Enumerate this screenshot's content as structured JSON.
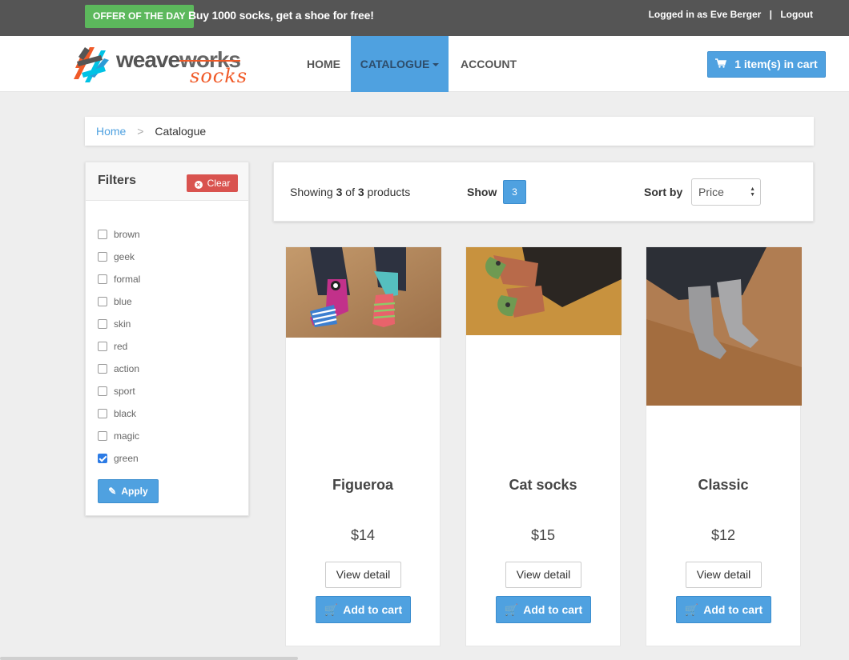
{
  "topbar": {
    "offer_badge": "OFFER OF THE DAY",
    "offer_text": "Buy 1000 socks, get a shoe for free!",
    "logged_in": "Logged in as Eve Berger",
    "separator": "|",
    "logout": "Logout"
  },
  "logo": {
    "word": "weave",
    "word2": "works",
    "sub": "socks"
  },
  "nav": {
    "home": "HOME",
    "catalogue": "CATALOGUE",
    "account": "ACCOUNT",
    "cart": "1 item(s) in cart"
  },
  "breadcrumb": {
    "home": "Home",
    "separator": ">",
    "current": "Catalogue"
  },
  "filters": {
    "title": "Filters",
    "clear": "Clear",
    "apply": "Apply",
    "items": [
      {
        "label": "brown",
        "checked": false
      },
      {
        "label": "geek",
        "checked": false
      },
      {
        "label": "formal",
        "checked": false
      },
      {
        "label": "blue",
        "checked": false
      },
      {
        "label": "skin",
        "checked": false
      },
      {
        "label": "red",
        "checked": false
      },
      {
        "label": "action",
        "checked": false
      },
      {
        "label": "sport",
        "checked": false
      },
      {
        "label": "black",
        "checked": false
      },
      {
        "label": "magic",
        "checked": false
      },
      {
        "label": "green",
        "checked": true
      }
    ]
  },
  "info": {
    "showing_prefix": "Showing",
    "showing_count": "3",
    "showing_of": "of",
    "showing_total": "3",
    "showing_suffix": "products",
    "show_label": "Show",
    "show_value": "3",
    "sort_label": "Sort by",
    "sort_value": "Price"
  },
  "products": [
    {
      "name": "Figueroa",
      "price": "$14",
      "view": "View detail",
      "add": "Add to cart"
    },
    {
      "name": "Cat socks",
      "price": "$15",
      "view": "View detail",
      "add": "Add to cart"
    },
    {
      "name": "Classic",
      "price": "$12",
      "view": "View detail",
      "add": "Add to cart"
    }
  ],
  "colors": {
    "accent": "#4fa1e0",
    "offer": "#5cb85c",
    "danger": "#d9534f",
    "topbar": "#555555",
    "brand_orange": "#f05a28"
  },
  "icons": {
    "cart": "cart-icon",
    "clear": "times-circle-icon",
    "apply": "pencil-icon",
    "caret": "caret-down-icon"
  }
}
